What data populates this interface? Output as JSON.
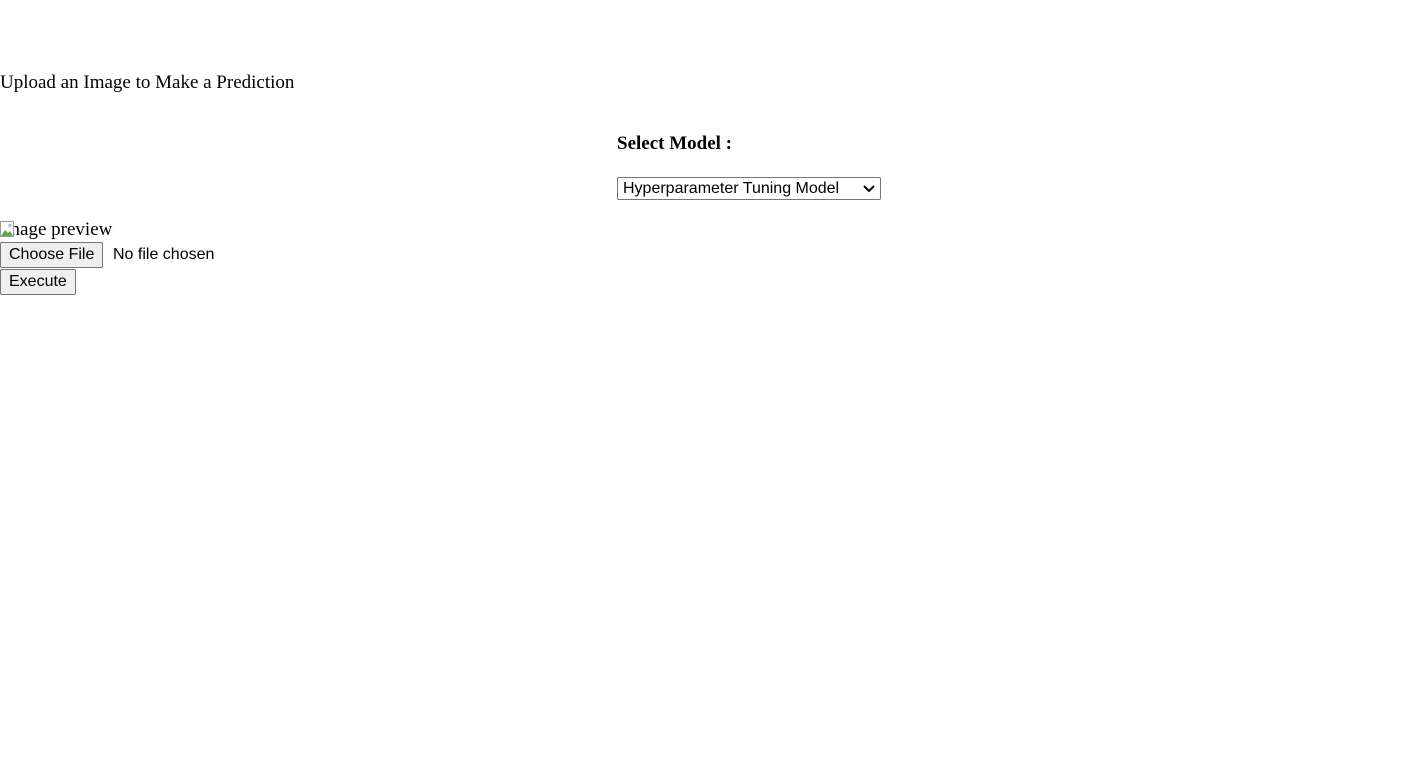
{
  "page": {
    "heading": "Upload an Image to Make a Prediction"
  },
  "model": {
    "label": "Select Model :",
    "selected": "Hyperparameter Tuning Model",
    "dropdown_icon": "chevron-down-icon"
  },
  "preview": {
    "alt_text": "image preview",
    "icon": "broken-image-icon"
  },
  "upload": {
    "choose_label": "Choose File",
    "status": "No file chosen"
  },
  "actions": {
    "execute_label": "Execute"
  }
}
